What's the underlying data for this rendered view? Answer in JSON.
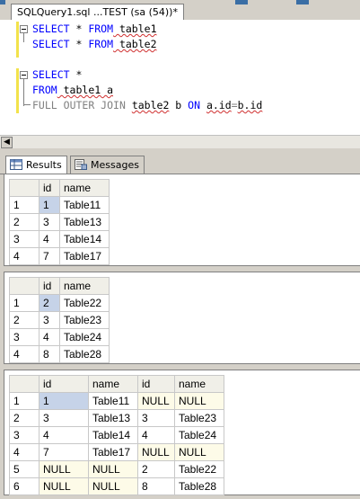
{
  "window": {
    "doc_tab_title": "SQLQuery1.sql ...TEST (sa (54))*"
  },
  "editor": {
    "lines": [
      {
        "kw1": "SELECT",
        "mid": " * ",
        "kw2": "FROM",
        "tail": " table1"
      },
      {
        "kw1": "SELECT",
        "mid": " * ",
        "kw2": "FROM",
        "tail": " table2"
      },
      {
        "kw1": "SELECT",
        "mid": " *",
        "kw2": "",
        "tail": ""
      },
      {
        "kw1": "FROM",
        "mid": " table1 a",
        "kw2": "",
        "tail": ""
      },
      {
        "kw1": "FULL",
        "outer": "OUTER JOIN",
        "tbl": "table2",
        "b": " b ",
        "on": "ON",
        "cond1": "a.id",
        "eq": "=",
        "cond2": "b.id"
      }
    ]
  },
  "results_tabs": [
    {
      "label": "Results",
      "icon": "grid-icon"
    },
    {
      "label": "Messages",
      "icon": "messages-icon"
    }
  ],
  "grid1": {
    "headers": [
      "id",
      "name"
    ],
    "rows": [
      [
        "1",
        "1",
        "Table11"
      ],
      [
        "2",
        "3",
        "Table13"
      ],
      [
        "3",
        "4",
        "Table14"
      ],
      [
        "4",
        "7",
        "Table17"
      ]
    ]
  },
  "grid2": {
    "headers": [
      "id",
      "name"
    ],
    "rows": [
      [
        "1",
        "2",
        "Table22"
      ],
      [
        "2",
        "3",
        "Table23"
      ],
      [
        "3",
        "4",
        "Table24"
      ],
      [
        "4",
        "8",
        "Table28"
      ]
    ]
  },
  "grid3": {
    "headers": [
      "id",
      "name",
      "id",
      "name"
    ],
    "rows": [
      [
        "1",
        "1",
        "Table11",
        "NULL",
        "NULL"
      ],
      [
        "2",
        "3",
        "Table13",
        "3",
        "Table23"
      ],
      [
        "3",
        "4",
        "Table14",
        "4",
        "Table24"
      ],
      [
        "4",
        "7",
        "Table17",
        "NULL",
        "NULL"
      ],
      [
        "5",
        "NULL",
        "NULL",
        "2",
        "Table22"
      ],
      [
        "6",
        "NULL",
        "NULL",
        "8",
        "Table28"
      ]
    ]
  },
  "colors": {
    "keyword": "#0000ff",
    "gray_keyword": "#808080",
    "selection": "#c6d3e8",
    "null_cell": "#fdfbe8"
  }
}
